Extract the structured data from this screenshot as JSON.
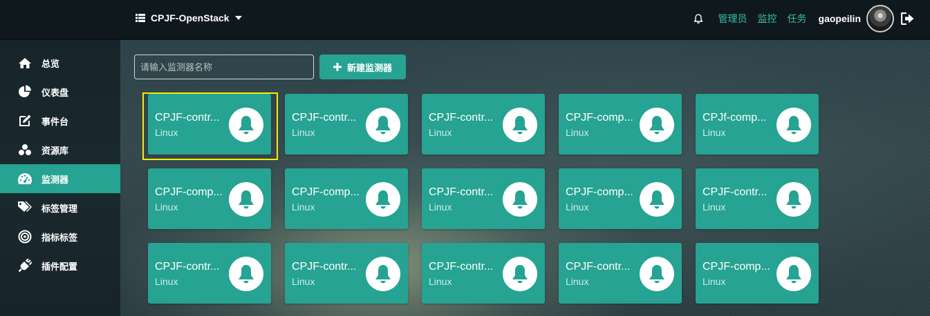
{
  "header": {
    "project_name": "CPJF-OpenStack",
    "links": [
      "管理员",
      "监控",
      "任务"
    ],
    "username": "gaopeilin"
  },
  "sidebar": {
    "items": [
      {
        "label": "总览",
        "icon": "home-icon"
      },
      {
        "label": "仪表盘",
        "icon": "pie-chart-icon"
      },
      {
        "label": "事件台",
        "icon": "edit-icon"
      },
      {
        "label": "资源库",
        "icon": "cubes-icon"
      },
      {
        "label": "监测器",
        "icon": "dashboard-icon",
        "active": true
      },
      {
        "label": "标签管理",
        "icon": "tags-icon"
      },
      {
        "label": "指标标签",
        "icon": "bullseye-icon"
      },
      {
        "label": "插件配置",
        "icon": "plug-icon"
      }
    ]
  },
  "toolbar": {
    "search_placeholder": "请输入监测器名称",
    "add_button_label": "新建监测器"
  },
  "monitors": [
    {
      "name": "CPJF-contr...",
      "os": "Linux"
    },
    {
      "name": "CPJF-contr...",
      "os": "Linux"
    },
    {
      "name": "CPJF-contr...",
      "os": "Linux"
    },
    {
      "name": "CPJF-comp...",
      "os": "Linux"
    },
    {
      "name": "CPJf-comp...",
      "os": "Linux"
    },
    {
      "name": "CPJF-comp...",
      "os": "Linux"
    },
    {
      "name": "CPJF-comp...",
      "os": "Linux"
    },
    {
      "name": "CPJF-contr...",
      "os": "Linux"
    },
    {
      "name": "CPJF-comp...",
      "os": "Linux"
    },
    {
      "name": "CPJF-contr...",
      "os": "Linux"
    },
    {
      "name": "CPJF-contr...",
      "os": "Linux"
    },
    {
      "name": "CPJF-contr...",
      "os": "Linux"
    },
    {
      "name": "CPJF-contr...",
      "os": "Linux"
    },
    {
      "name": "CPJF-contr...",
      "os": "Linux"
    },
    {
      "name": "CPJF-comp...",
      "os": "Linux"
    }
  ],
  "colors": {
    "accent": "#26a392",
    "link": "#33c2ad",
    "highlight": "#f5ef00"
  }
}
